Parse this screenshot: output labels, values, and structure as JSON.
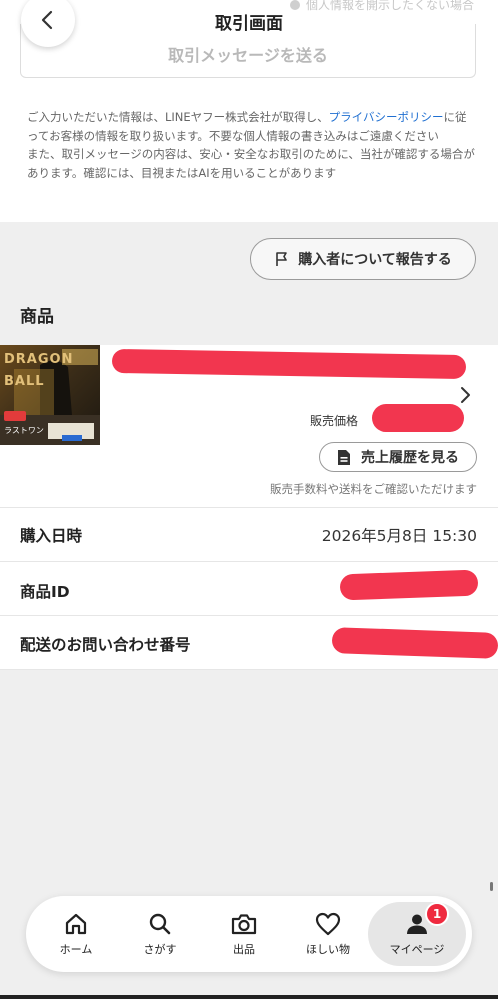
{
  "header": {
    "title": "取引画面",
    "hidden_banner": "個人情報を開示したくない場合",
    "message_button": "取引メッセージを送る"
  },
  "notice": {
    "part1": "ご入力いただいた情報は、LINEヤフー株式会社が取得し、",
    "privacy_link": "プライバシーポリシー",
    "part2": "に従ってお客様の情報を取り扱います。不要な個人情報の書き込みはご遠慮ください",
    "part3": "また、取引メッセージの内容は、安心・安全なお取引のために、当社が確認する場合があります。確認には、目視またはAIを用いることがあります"
  },
  "report_button": "購入者について報告する",
  "product_section": {
    "title": "商品",
    "thumbnail_text": "DRAGON BALL",
    "thumbnail_sub": "ラストワン",
    "price_label": "販売価格",
    "history_button": "売上履歴を見る",
    "fee_note": "販売手数料や送料をご確認いただけます"
  },
  "info_rows": [
    {
      "label": "購入日時",
      "value": "2026年5月8日 15:30"
    },
    {
      "label": "商品ID",
      "value": ""
    },
    {
      "label": "配送のお問い合わせ番号",
      "value": ""
    }
  ],
  "bottom_nav": {
    "items": [
      {
        "label": "ホーム",
        "icon": "home-icon"
      },
      {
        "label": "さがす",
        "icon": "search-icon"
      },
      {
        "label": "出品",
        "icon": "camera-icon"
      },
      {
        "label": "ほしい物",
        "icon": "heart-icon"
      },
      {
        "label": "マイページ",
        "icon": "user-icon"
      }
    ],
    "active_index": 4,
    "badge_count": "1"
  },
  "colors": {
    "accent_link": "#1f6fd1",
    "redaction": "#f2364f",
    "badge": "#ef2a3f"
  }
}
